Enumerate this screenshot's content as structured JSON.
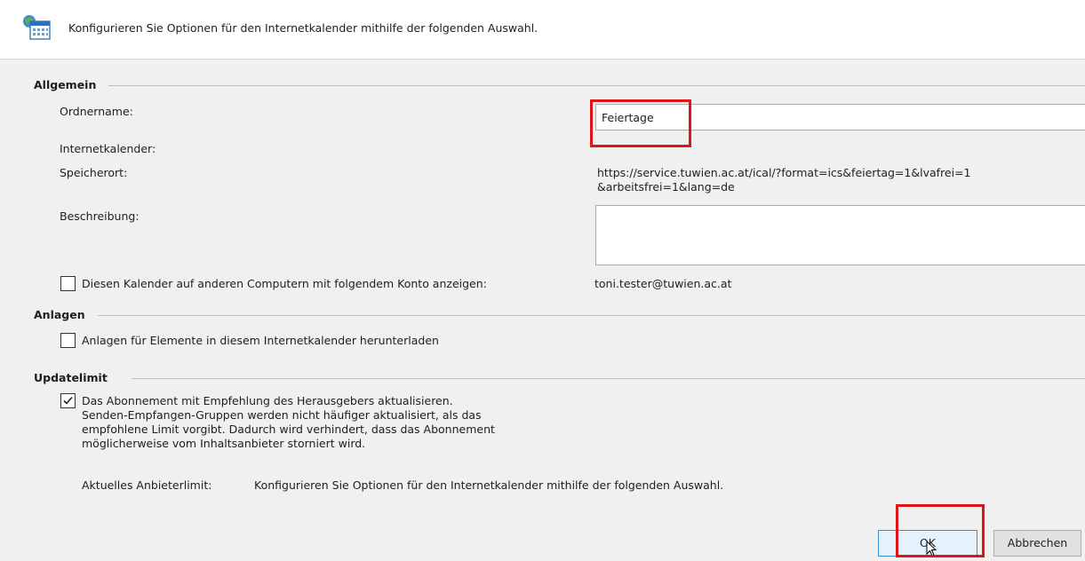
{
  "header": {
    "text": "Konfigurieren Sie Optionen für den Internetkalender mithilfe der folgenden Auswahl.",
    "icon": "calendar-globe-icon"
  },
  "general": {
    "title": "Allgemein",
    "folder_label": "Ordnername:",
    "folder_value": "Feiertage",
    "calendar_label": "Internetkalender:",
    "location_label": "Speicherort:",
    "location_line1": "https://service.tuwien.ac.at/ical/?format=ics&feiertag=1&lvafrei=1",
    "location_line2": "&arbeitsfrei=1&lang=de",
    "description_label": "Beschreibung:",
    "description_value": "",
    "show_other_label": "Diesen Kalender auf anderen Computern mit folgendem Konto anzeigen:",
    "show_other_checked": false,
    "account": "toni.tester@tuwien.ac.at"
  },
  "attachments": {
    "title": "Anlagen",
    "download_label": "Anlagen für Elemente in diesem Internetkalender herunterladen",
    "download_checked": false
  },
  "update_limit": {
    "title": "Updatelimit",
    "subscribe_line1": "Das Abonnement mit Empfehlung des Herausgebers aktualisieren.",
    "subscribe_line2": "Senden-Empfangen-Gruppen werden nicht häufiger aktualisiert, als das",
    "subscribe_line3": "empfohlene Limit vorgibt. Dadurch wird verhindert, dass das Abonnement",
    "subscribe_line4": "möglicherweise vom Inhaltsanbieter storniert wird.",
    "subscribe_checked": true,
    "provider_limit_label": "Aktuelles Anbieterlimit:",
    "provider_limit_value": "Konfigurieren Sie Optionen für den Internetkalender mithilfe der folgenden Auswahl."
  },
  "buttons": {
    "ok": "OK",
    "cancel": "Abbrechen"
  },
  "colors": {
    "highlight": "#e0141b",
    "ok_border": "#3c8fd6"
  }
}
